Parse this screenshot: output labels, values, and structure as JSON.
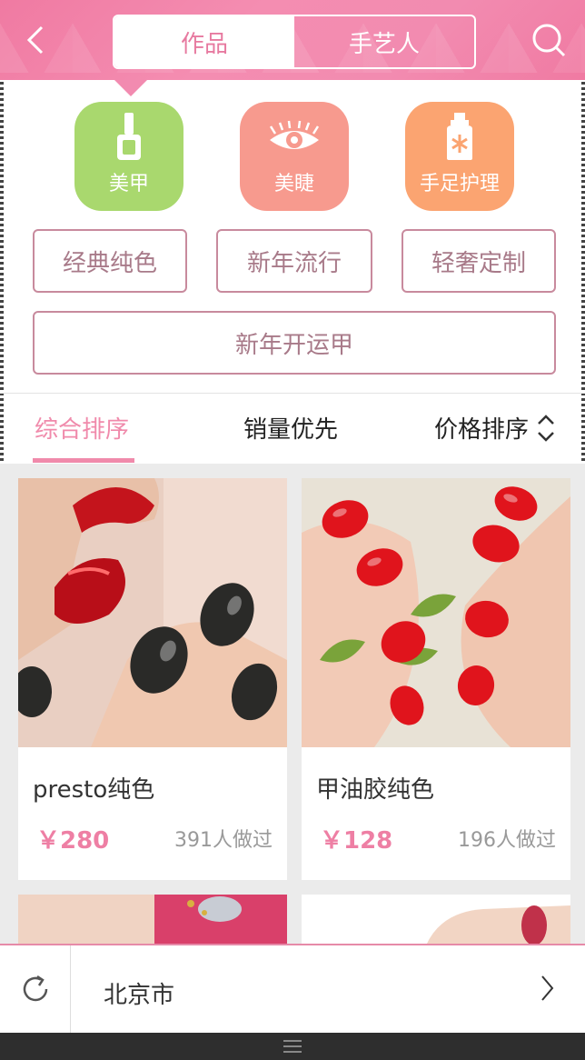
{
  "header": {
    "tabs": [
      {
        "label": "作品",
        "active": true
      },
      {
        "label": "手艺人",
        "active": false
      }
    ],
    "back_icon": "chevron-left-icon",
    "search_icon": "search-icon"
  },
  "categories": [
    {
      "label": "美甲",
      "icon": "nail-polish-icon",
      "color": "#a9d86e"
    },
    {
      "label": "美睫",
      "icon": "eyelash-icon",
      "color": "#f79a8e"
    },
    {
      "label": "手足护理",
      "icon": "lotion-bottle-icon",
      "color": "#fba471"
    }
  ],
  "tags": [
    "经典纯色",
    "新年流行",
    "轻奢定制",
    "新年开运甲"
  ],
  "sort": {
    "items": [
      "综合排序",
      "销量优先",
      "价格排序"
    ],
    "active_index": 0,
    "accent": "#f08aab"
  },
  "products": [
    {
      "title": "presto纯色",
      "price": "￥280",
      "count": "391人做过"
    },
    {
      "title": "甲油胶纯色",
      "price": "￥128",
      "count": "196人做过"
    }
  ],
  "location": {
    "city": "北京市",
    "refresh_icon": "refresh-icon",
    "arrow_icon": "chevron-right-icon"
  },
  "system": {
    "menu_icon": "menu-icon"
  }
}
